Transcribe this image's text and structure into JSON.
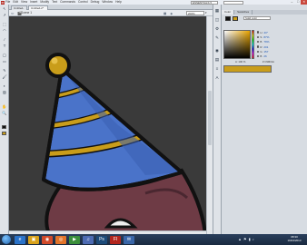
{
  "window": {
    "logo": "Fl",
    "controls": [
      "–",
      "□",
      "✕"
    ]
  },
  "menu": [
    "File",
    "Edit",
    "View",
    "Insert",
    "Modify",
    "Text",
    "Commands",
    "Control",
    "Debug",
    "Window",
    "Help"
  ],
  "workspace": "ESSENTIALS ▾",
  "tabs": [
    "Untitled-1",
    "Untitled-2*"
  ],
  "editbar": {
    "scene": "Scene 1",
    "zoom": "200%"
  },
  "tools": [
    "↖",
    "↗",
    "⬚",
    "◠",
    "∕",
    "T",
    "◯",
    "▭",
    "✎",
    "🖌",
    "◐",
    "▨",
    "✋",
    "🔍"
  ],
  "color_panel": {
    "tabs": [
      "Color",
      "Swatches"
    ],
    "color_type": "Solid color",
    "stroke_color": "#111111",
    "fill_color": "#c99d1a",
    "hsb_rgb": [
      {
        "label": "H",
        "value": "43°"
      },
      {
        "label": "S",
        "value": "87%"
      },
      {
        "label": "B",
        "value": "79%"
      },
      {
        "label": "R",
        "value": "201"
      },
      {
        "label": "G",
        "value": "157"
      },
      {
        "label": "B",
        "value": "26"
      }
    ],
    "alpha": "A: 100 %",
    "hex": "# C99D1A"
  },
  "panel_icons": [
    "▦",
    "◫",
    "⚙",
    "✎",
    "◉",
    "▤",
    "≡",
    "A"
  ],
  "taskbar": {
    "apps": [
      {
        "icon": "e",
        "color": "#2b73c9"
      },
      {
        "icon": "▣",
        "color": "#d9a21b"
      },
      {
        "icon": "◉",
        "color": "#d14a2a"
      },
      {
        "icon": "◎",
        "color": "#e2742a"
      },
      {
        "icon": "▶",
        "color": "#3b8f3b"
      },
      {
        "icon": "♫",
        "color": "#4d6bb3"
      },
      {
        "icon": "Ps",
        "color": "#1d4b7a"
      },
      {
        "icon": "Fl",
        "color": "#b3261e"
      },
      {
        "icon": "✉",
        "color": "#3a66a8"
      }
    ],
    "tray": [
      "▲",
      "⚑",
      "▮",
      "♪"
    ],
    "time": "08:30",
    "date": "16/04/2013"
  },
  "colors": {
    "stage": "#3a3a3a",
    "hat_blue": "#4a73c9",
    "hat_stripe": "#c99d1a",
    "creature": "#6e3b45"
  }
}
